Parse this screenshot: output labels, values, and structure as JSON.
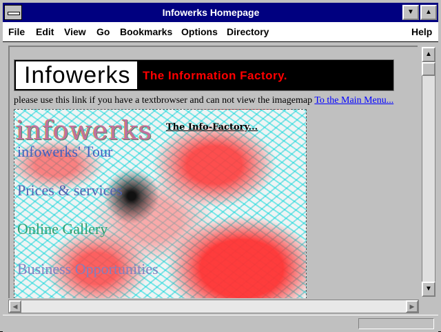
{
  "window": {
    "title": "Infowerks Homepage"
  },
  "menu": {
    "file": "File",
    "edit": "Edit",
    "view": "View",
    "go": "Go",
    "bookmarks": "Bookmarks",
    "options": "Options",
    "directory": "Directory",
    "help": "Help"
  },
  "banner": {
    "title": "Infowerks",
    "slogan": "The Information Factory."
  },
  "intro": {
    "text": "please use this link if you have a textbrowser and can not view the imagemap ",
    "link": "To the Main Menu..."
  },
  "imagemap": {
    "logo_text": "infowerks",
    "subtitle": "The Info-Factory...",
    "links": [
      "infowerks' Tour",
      "Prices & services",
      "Online Gallery",
      "Business Opportunities"
    ]
  },
  "status": {
    "text": ""
  },
  "colors": {
    "title_bar": "#000080",
    "slogan": "#ff0000",
    "link": "#0000ff"
  }
}
